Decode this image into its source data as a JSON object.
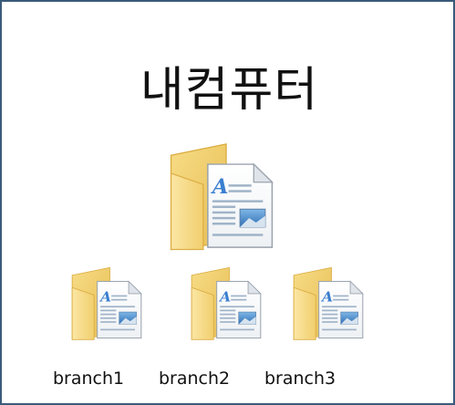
{
  "title": "내컴퓨터",
  "root": {
    "icon": "folder-document-icon"
  },
  "branches": [
    {
      "label": "branch1",
      "icon": "folder-document-icon"
    },
    {
      "label": "branch2",
      "icon": "folder-document-icon"
    },
    {
      "label": "branch3",
      "icon": "folder-document-icon"
    }
  ],
  "colors": {
    "border": "#3a5a7a",
    "folder_light": "#f6dc8a",
    "folder_dark": "#e3b948",
    "doc_accent": "#3b7fd0"
  }
}
